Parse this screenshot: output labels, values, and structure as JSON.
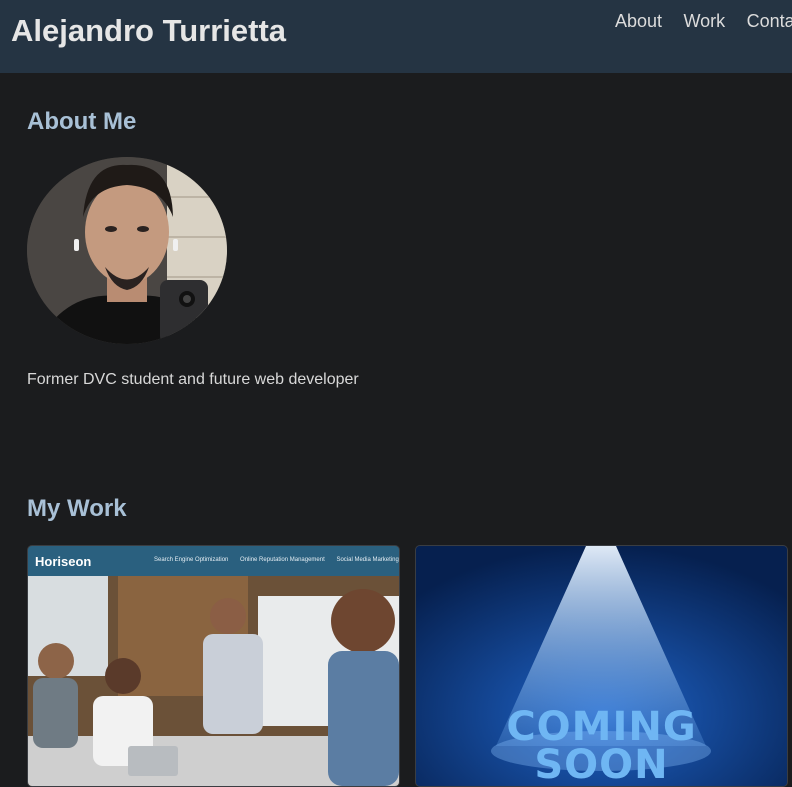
{
  "header": {
    "title": "Alejandro Turrietta",
    "nav": [
      "About",
      "Work",
      "Contact"
    ]
  },
  "about": {
    "heading": "About Me",
    "description": "Former DVC student and future web developer",
    "avatar_icon": "profile-photo"
  },
  "work": {
    "heading": "My Work",
    "cards": [
      {
        "logo": "Horiseon",
        "links": [
          "Search Engine Optimization",
          "Online Reputation Management",
          "Social Media Marketing"
        ]
      },
      {
        "text_line1": "COMING",
        "text_line2": "SOON"
      }
    ]
  },
  "colors": {
    "background": "#1b1c1e",
    "header": "#253443",
    "heading": "#a8c0d6"
  }
}
